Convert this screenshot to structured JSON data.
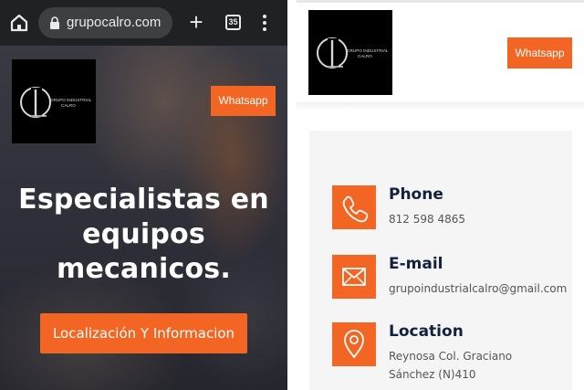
{
  "browser": {
    "url": "grupocalro.com",
    "tab_count": "35",
    "icons": [
      "home-icon",
      "lock-icon",
      "new-tab-icon",
      "tab-switcher-icon",
      "menu-icon"
    ]
  },
  "brand": {
    "logo_line1": "GRUPO INDUSTRIAL",
    "logo_line2": "CALRO",
    "accent_color": "#f26522",
    "dark_text_color": "#14213d"
  },
  "hero": {
    "whatsapp_label": "Whatsapp",
    "headline_line1": "Especialistas en",
    "headline_line2": "equipos",
    "headline_line3": "mecanicos.",
    "cta_label": "Localización Y Informacion"
  },
  "contact_page": {
    "whatsapp_label": "Whatsapp",
    "items": [
      {
        "title": "Phone",
        "value_line1": "812 598 4865",
        "value_line2": "",
        "icon": "phone-icon"
      },
      {
        "title": "E-mail",
        "value_line1": "grupoindustrialcalro@gmail.com",
        "value_line2": "",
        "icon": "envelope-icon"
      },
      {
        "title": "Location",
        "value_line1": "Reynosa Col. Graciano",
        "value_line2": "Sánchez (N)410",
        "icon": "location-pin-icon"
      }
    ]
  }
}
